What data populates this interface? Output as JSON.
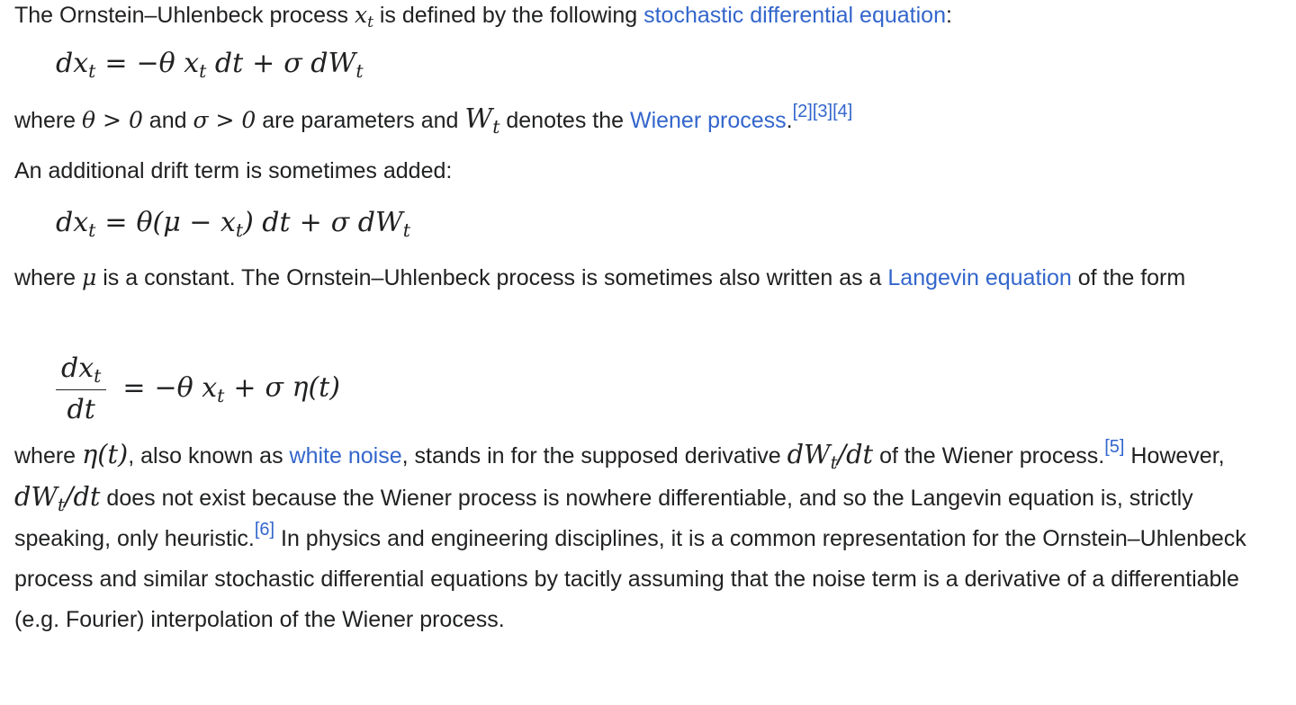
{
  "p1": {
    "text_a": "The Ornstein–Uhlenbeck process ",
    "math_x": "x",
    "math_x_sub": "t",
    "text_b": " is defined by the following ",
    "link_sde": "stochastic differential equation",
    "text_c": ":"
  },
  "eq1": {
    "lhs": "dx",
    "lhs_sub": "t",
    "eq": "=",
    "rhs_a": "−θ x",
    "rhs_a_sub": "t",
    "rhs_b": " dt",
    "plus": "+",
    "rhs_c": "σ dW",
    "rhs_c_sub": "t"
  },
  "p2": {
    "text_a": "where ",
    "math_a": "θ > 0",
    "text_b": " and ",
    "math_b": "σ > 0",
    "text_c": " are parameters and ",
    "math_w": "W",
    "math_w_sub": "t",
    "text_d": " denotes the ",
    "link_wiener": "Wiener process",
    "text_e": ".",
    "refs": [
      "[2]",
      "[3]",
      "[4]"
    ]
  },
  "p3": {
    "text": "An additional drift term is sometimes added:"
  },
  "eq2": {
    "lhs": "dx",
    "lhs_sub": "t",
    "eq": "=",
    "rhs_a": "θ(μ − x",
    "rhs_a_sub": "t",
    "rhs_b": ") dt",
    "plus": "+",
    "rhs_c": "σ dW",
    "rhs_c_sub": "t"
  },
  "p4": {
    "text_a": "where ",
    "math_mu": "μ",
    "text_b": " is a constant. The Ornstein–Uhlenbeck process is sometimes also written as a ",
    "link_langevin": "Langevin equation",
    "text_c": " of the form"
  },
  "eq3": {
    "num": "dx",
    "num_sub": "t",
    "den": "dt",
    "eq": "=",
    "rhs_a": "−θ x",
    "rhs_a_sub": "t",
    "plus": "+",
    "rhs_b": "σ η(t)"
  },
  "p5": {
    "text_a": "where ",
    "math_eta": "η(t)",
    "text_b": ", also known as ",
    "link_white_noise": "white noise",
    "text_c": ", stands in for the supposed derivative ",
    "math_dw1": "dW",
    "math_dw1_sub": "t",
    "math_dw1_tail": "/dt",
    "text_d": " of the Wiener process.",
    "ref5": "[5]",
    "text_e": " However, ",
    "math_dw2": "dW",
    "math_dw2_sub": "t",
    "math_dw2_tail": "/dt",
    "text_f": " does not exist because the Wiener process is nowhere differentiable, and so the Langevin equation is, strictly speaking, only heuristic.",
    "ref6": "[6]",
    "text_g": " In physics and engineering disciplines, it is a common representation for the Ornstein–Uhlenbeck process and similar stochastic differential equations by tacitly assuming that the noise term is a derivative of a differentiable (e.g. Fourier) interpolation of the Wiener process."
  }
}
